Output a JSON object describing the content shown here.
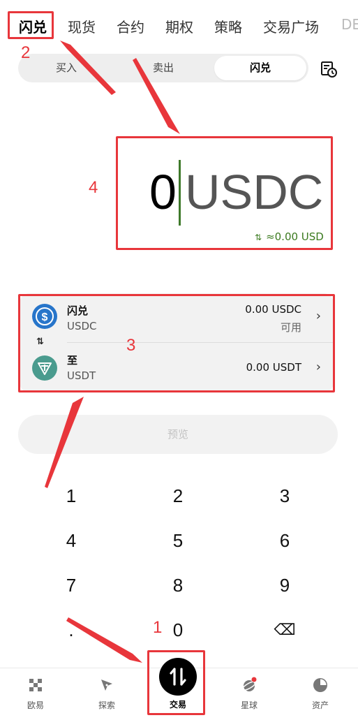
{
  "top_tabs": [
    "闪兑",
    "现货",
    "合约",
    "期权",
    "策略",
    "交易广场",
    "DE"
  ],
  "segment": {
    "buy": "买入",
    "sell": "卖出",
    "flash": "闪兑"
  },
  "amount": {
    "value": "0",
    "unit": "USDC",
    "usd_equiv": "≈0.00 USD",
    "swap_glyph": "⇅"
  },
  "from_asset": {
    "label": "闪兑",
    "symbol": "USDC",
    "amount": "0.00 USDC",
    "available": "可用"
  },
  "to_asset": {
    "label": "至",
    "symbol": "USDT",
    "amount": "0.00 USDT"
  },
  "swap_direction": "⇅",
  "preview_label": "预览",
  "keypad": [
    "1",
    "2",
    "3",
    "4",
    "5",
    "6",
    "7",
    "8",
    "9",
    ".",
    "0",
    "⌫"
  ],
  "bottom_nav": {
    "okx": "欧易",
    "explore": "探索",
    "trade": "交易",
    "planet": "星球",
    "assets": "资产"
  },
  "annotations": {
    "n1": "1",
    "n2": "2",
    "n3": "3",
    "n4": "4"
  },
  "colors": {
    "accent_green": "#3b7a1f",
    "annotation_red": "#e8363b",
    "usdc_blue": "#2775ca",
    "usdt_teal": "#4a9b8e"
  },
  "icons": {
    "history": "history-clock-icon",
    "back": "backspace-icon",
    "chevron": "chevron-right-icon"
  }
}
